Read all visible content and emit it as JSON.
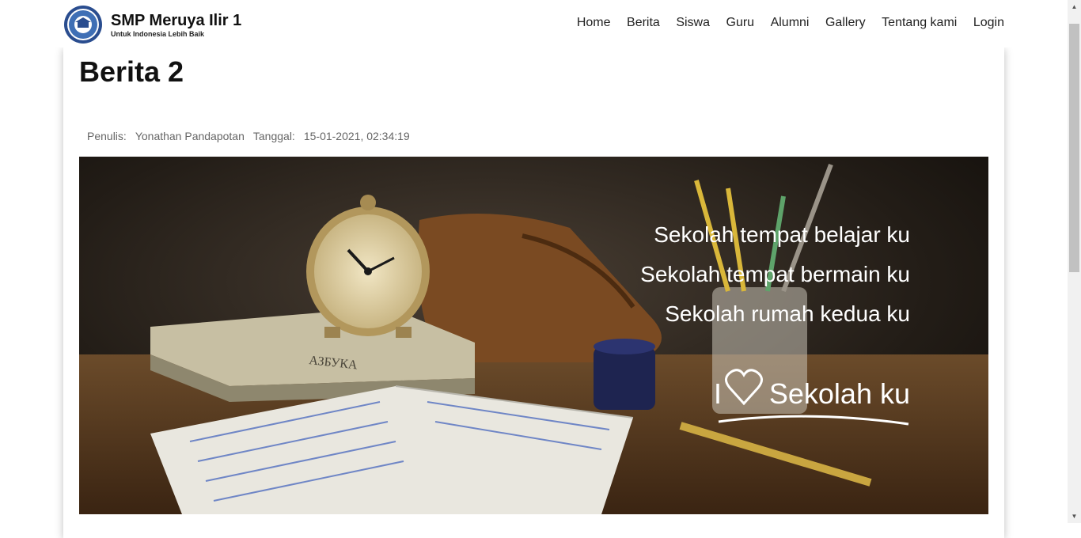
{
  "brand": {
    "title": "SMP Meruya Ilir 1",
    "subtitle": "Untuk Indonesia Lebih Baik"
  },
  "nav": [
    "Home",
    "Berita",
    "Siswa",
    "Guru",
    "Alumni",
    "Gallery",
    "Tentang kami",
    "Login"
  ],
  "article": {
    "title": "Berita 2",
    "author_label": "Penulis:",
    "author": "Yonathan Pandapotan",
    "date_label": "Tanggal:",
    "date": "15-01-2021, 02:34:19"
  },
  "hero": {
    "line1": "Sekolah tempat belajar ku",
    "line2": "Sekolah tempat bermain ku",
    "line3": "Sekolah rumah kedua ku",
    "love_prefix": "I",
    "love_suffix": "Sekolah ku",
    "book_spine": "АЗБУКА"
  }
}
